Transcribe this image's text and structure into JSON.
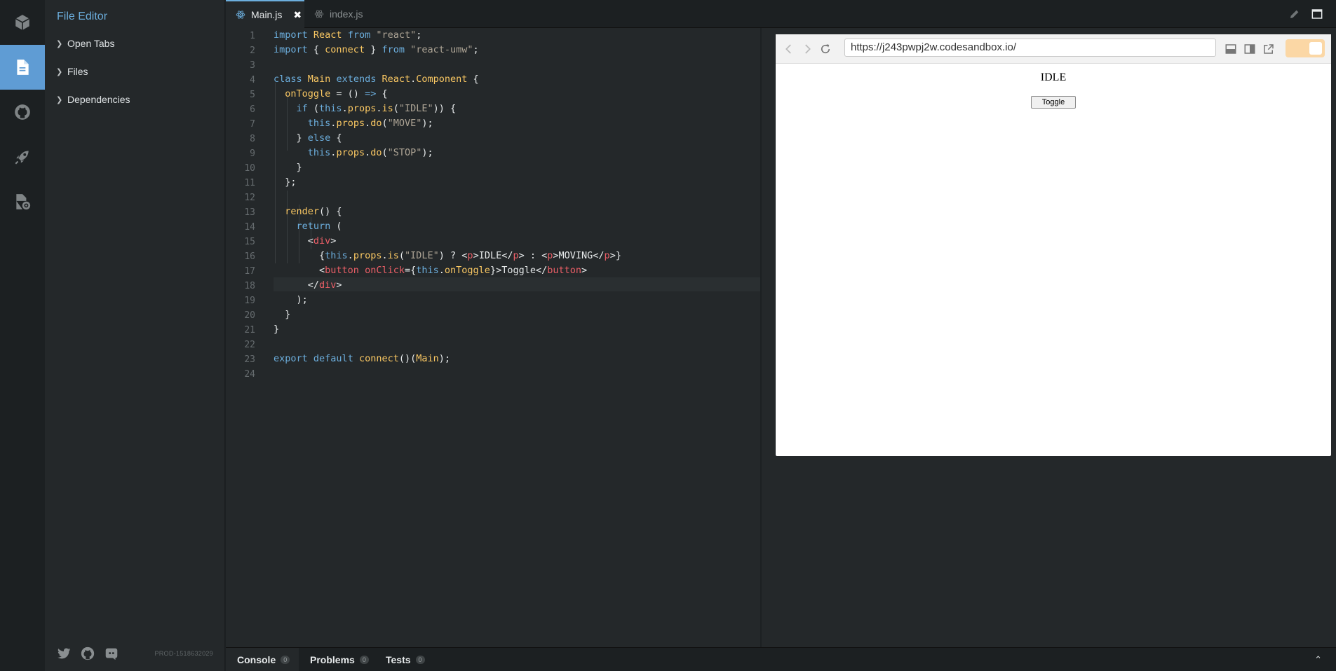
{
  "sidebar": {
    "title": "File Editor",
    "items": [
      {
        "label": "Open Tabs"
      },
      {
        "label": "Files"
      },
      {
        "label": "Dependencies"
      }
    ],
    "build": "PROD-1518632029"
  },
  "tabs": [
    {
      "label": "Main.js",
      "active": true
    },
    {
      "label": "index.js",
      "active": false
    }
  ],
  "preview": {
    "url": "https://j243pwpj2w.codesandbox.io/",
    "state_text": "IDLE",
    "button_label": "Toggle"
  },
  "bottom": {
    "tabs": [
      {
        "label": "Console",
        "count": "0"
      },
      {
        "label": "Problems",
        "count": "0"
      },
      {
        "label": "Tests",
        "count": "0"
      }
    ]
  },
  "code": {
    "line_numbers": [
      "1",
      "2",
      "3",
      "4",
      "5",
      "6",
      "7",
      "8",
      "9",
      "10",
      "11",
      "12",
      "13",
      "14",
      "15",
      "16",
      "17",
      "18",
      "19",
      "20",
      "21",
      "22",
      "23",
      "24"
    ],
    "lines": [
      "import React from \"react\";",
      "import { connect } from \"react-umw\";",
      "",
      "class Main extends React.Component {",
      "  onToggle = () => {",
      "    if (this.props.is(\"IDLE\")) {",
      "      this.props.do(\"MOVE\");",
      "    } else {",
      "      this.props.do(\"STOP\");",
      "    }",
      "  };",
      "",
      "  render() {",
      "    return (",
      "      <div>",
      "        {this.props.is(\"IDLE\") ? <p>IDLE</p> : <p>MOVING</p>}",
      "        <button onClick={this.onToggle}>Toggle</button>",
      "      </div>",
      "    );",
      "  }",
      "}",
      "",
      "export default connect()(Main);",
      ""
    ]
  },
  "colors": {
    "accent": "#6caedd",
    "active_activity": "#5f9cd4",
    "toggle": "#fbd7a5"
  },
  "icons": {
    "activity": [
      "cube-icon",
      "file-icon",
      "github-icon",
      "rocket-icon",
      "settings-file-icon"
    ],
    "footer": [
      "twitter-icon",
      "github-icon",
      "discord-icon"
    ]
  }
}
